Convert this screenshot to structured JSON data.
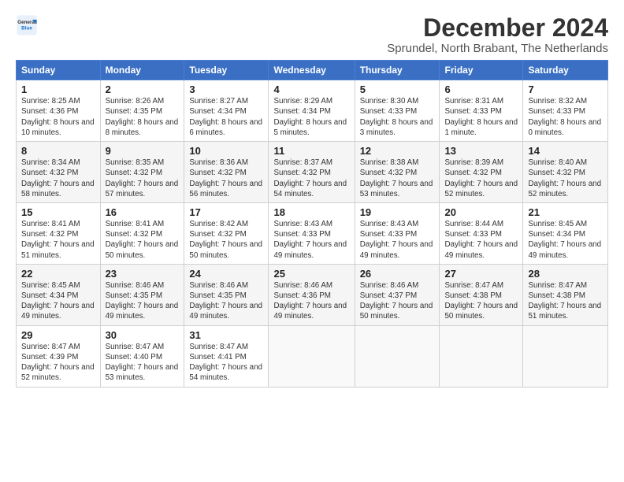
{
  "logo": {
    "line1": "General",
    "line2": "Blue"
  },
  "title": "December 2024",
  "subtitle": "Sprundel, North Brabant, The Netherlands",
  "days_header": [
    "Sunday",
    "Monday",
    "Tuesday",
    "Wednesday",
    "Thursday",
    "Friday",
    "Saturday"
  ],
  "weeks": [
    [
      {
        "day": "1",
        "sunrise": "8:25 AM",
        "sunset": "4:36 PM",
        "daylight": "8 hours and 10 minutes."
      },
      {
        "day": "2",
        "sunrise": "8:26 AM",
        "sunset": "4:35 PM",
        "daylight": "8 hours and 8 minutes."
      },
      {
        "day": "3",
        "sunrise": "8:27 AM",
        "sunset": "4:34 PM",
        "daylight": "8 hours and 6 minutes."
      },
      {
        "day": "4",
        "sunrise": "8:29 AM",
        "sunset": "4:34 PM",
        "daylight": "8 hours and 5 minutes."
      },
      {
        "day": "5",
        "sunrise": "8:30 AM",
        "sunset": "4:33 PM",
        "daylight": "8 hours and 3 minutes."
      },
      {
        "day": "6",
        "sunrise": "8:31 AM",
        "sunset": "4:33 PM",
        "daylight": "8 hours and 1 minute."
      },
      {
        "day": "7",
        "sunrise": "8:32 AM",
        "sunset": "4:33 PM",
        "daylight": "8 hours and 0 minutes."
      }
    ],
    [
      {
        "day": "8",
        "sunrise": "8:34 AM",
        "sunset": "4:32 PM",
        "daylight": "7 hours and 58 minutes."
      },
      {
        "day": "9",
        "sunrise": "8:35 AM",
        "sunset": "4:32 PM",
        "daylight": "7 hours and 57 minutes."
      },
      {
        "day": "10",
        "sunrise": "8:36 AM",
        "sunset": "4:32 PM",
        "daylight": "7 hours and 56 minutes."
      },
      {
        "day": "11",
        "sunrise": "8:37 AM",
        "sunset": "4:32 PM",
        "daylight": "7 hours and 54 minutes."
      },
      {
        "day": "12",
        "sunrise": "8:38 AM",
        "sunset": "4:32 PM",
        "daylight": "7 hours and 53 minutes."
      },
      {
        "day": "13",
        "sunrise": "8:39 AM",
        "sunset": "4:32 PM",
        "daylight": "7 hours and 52 minutes."
      },
      {
        "day": "14",
        "sunrise": "8:40 AM",
        "sunset": "4:32 PM",
        "daylight": "7 hours and 52 minutes."
      }
    ],
    [
      {
        "day": "15",
        "sunrise": "8:41 AM",
        "sunset": "4:32 PM",
        "daylight": "7 hours and 51 minutes."
      },
      {
        "day": "16",
        "sunrise": "8:41 AM",
        "sunset": "4:32 PM",
        "daylight": "7 hours and 50 minutes."
      },
      {
        "day": "17",
        "sunrise": "8:42 AM",
        "sunset": "4:32 PM",
        "daylight": "7 hours and 50 minutes."
      },
      {
        "day": "18",
        "sunrise": "8:43 AM",
        "sunset": "4:33 PM",
        "daylight": "7 hours and 49 minutes."
      },
      {
        "day": "19",
        "sunrise": "8:43 AM",
        "sunset": "4:33 PM",
        "daylight": "7 hours and 49 minutes."
      },
      {
        "day": "20",
        "sunrise": "8:44 AM",
        "sunset": "4:33 PM",
        "daylight": "7 hours and 49 minutes."
      },
      {
        "day": "21",
        "sunrise": "8:45 AM",
        "sunset": "4:34 PM",
        "daylight": "7 hours and 49 minutes."
      }
    ],
    [
      {
        "day": "22",
        "sunrise": "8:45 AM",
        "sunset": "4:34 PM",
        "daylight": "7 hours and 49 minutes."
      },
      {
        "day": "23",
        "sunrise": "8:46 AM",
        "sunset": "4:35 PM",
        "daylight": "7 hours and 49 minutes."
      },
      {
        "day": "24",
        "sunrise": "8:46 AM",
        "sunset": "4:35 PM",
        "daylight": "7 hours and 49 minutes."
      },
      {
        "day": "25",
        "sunrise": "8:46 AM",
        "sunset": "4:36 PM",
        "daylight": "7 hours and 49 minutes."
      },
      {
        "day": "26",
        "sunrise": "8:46 AM",
        "sunset": "4:37 PM",
        "daylight": "7 hours and 50 minutes."
      },
      {
        "day": "27",
        "sunrise": "8:47 AM",
        "sunset": "4:38 PM",
        "daylight": "7 hours and 50 minutes."
      },
      {
        "day": "28",
        "sunrise": "8:47 AM",
        "sunset": "4:38 PM",
        "daylight": "7 hours and 51 minutes."
      }
    ],
    [
      {
        "day": "29",
        "sunrise": "8:47 AM",
        "sunset": "4:39 PM",
        "daylight": "7 hours and 52 minutes."
      },
      {
        "day": "30",
        "sunrise": "8:47 AM",
        "sunset": "4:40 PM",
        "daylight": "7 hours and 53 minutes."
      },
      {
        "day": "31",
        "sunrise": "8:47 AM",
        "sunset": "4:41 PM",
        "daylight": "7 hours and 54 minutes."
      },
      null,
      null,
      null,
      null
    ]
  ]
}
